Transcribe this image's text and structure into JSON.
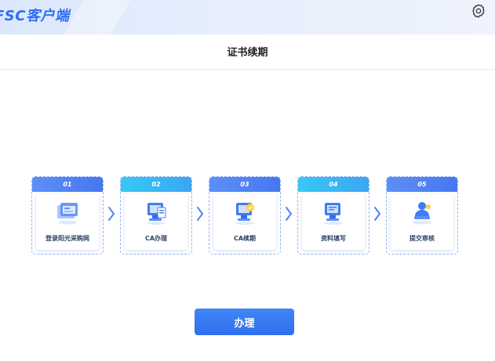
{
  "header": {
    "app_title": "FSC客户端",
    "settings_icon": "gear-icon"
  },
  "page": {
    "title": "证书续期"
  },
  "steps": [
    {
      "num": "01",
      "label": "登录阳光采购网",
      "icon": "monitor-window-icon",
      "color": "blue"
    },
    {
      "num": "02",
      "label": "CA办理",
      "icon": "monitor-document-icon",
      "color": "cyan"
    },
    {
      "num": "03",
      "label": "CA续期",
      "icon": "monitor-certificate-icon",
      "color": "blue"
    },
    {
      "num": "04",
      "label": "资料填写",
      "icon": "monitor-form-icon",
      "color": "cyan"
    },
    {
      "num": "05",
      "label": "提交审核",
      "icon": "user-submit-icon",
      "color": "blue"
    }
  ],
  "action": {
    "button_label": "办理"
  },
  "colors": {
    "primary": "#2f6ef0",
    "step_blue": "#4f83f3",
    "step_cyan": "#38bdf4",
    "background": "#ffffff"
  }
}
